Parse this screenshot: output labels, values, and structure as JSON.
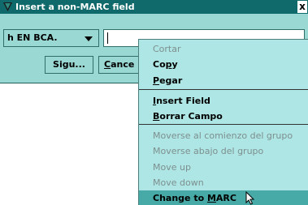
{
  "window": {
    "title": "Insert a non-MARC field",
    "close_label": "x",
    "icon": "app-logo-icon",
    "accent": "#10696b"
  },
  "form": {
    "field_select_value": "h  EN BCA.",
    "value_input": ""
  },
  "buttons": {
    "next_label": "Sigu...",
    "cancel_first": "C",
    "cancel_rest": "ance"
  },
  "context_menu": {
    "cut": "Cortar",
    "copy_pre": "Co",
    "copy_mn": "p",
    "copy_post": "y",
    "paste_mn": "P",
    "paste_post": "egar",
    "insert_mn": "I",
    "insert_post": "nsert Field",
    "delete_mn": "B",
    "delete_post": "orrar Campo",
    "move_group_start": "Moverse al comienzo del grupo",
    "move_group_down": "Moverse abajo del grupo",
    "move_up": "Move up",
    "move_down": "Move down",
    "change_pre": "Change to ",
    "change_mn": "M",
    "change_post": "ARC",
    "highlight_color": "#47aaa6"
  }
}
